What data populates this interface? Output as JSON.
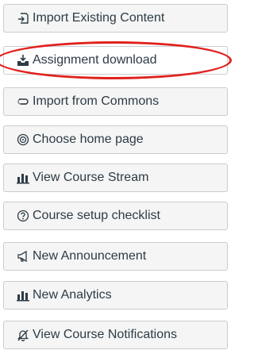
{
  "sidebar": {
    "buttons": [
      {
        "label": "Import Existing Content",
        "icon": "import-icon"
      },
      {
        "label": "Assignment download",
        "icon": "download-tray-icon"
      },
      {
        "label": "Import from Commons",
        "icon": "commons-icon"
      },
      {
        "label": "Choose home page",
        "icon": "target-icon"
      },
      {
        "label": "View Course Stream",
        "icon": "bar-chart-icon"
      },
      {
        "label": "Course setup checklist",
        "icon": "question-circle-icon"
      },
      {
        "label": "New Announcement",
        "icon": "megaphone-icon"
      },
      {
        "label": "New Analytics",
        "icon": "bar-chart-icon"
      },
      {
        "label": "View Course Notifications",
        "icon": "bell-off-icon"
      }
    ],
    "highlight_color": "#e0211d"
  }
}
